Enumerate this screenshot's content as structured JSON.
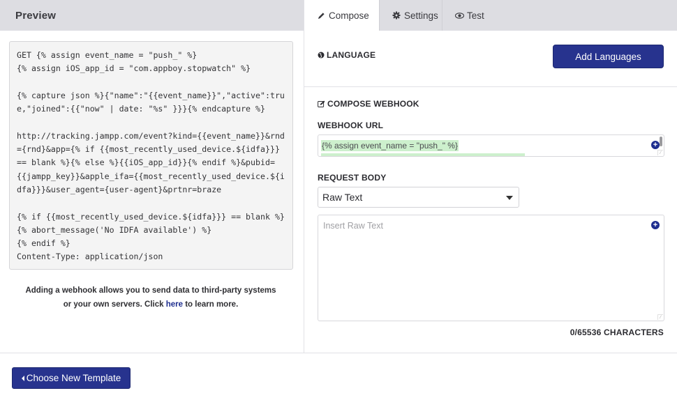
{
  "preview": {
    "title": "Preview",
    "code": "GET {% assign event_name = \"push_\" %}\n{% assign iOS_app_id = \"com.appboy.stopwatch\" %}\n\n{% capture json %}{\"name\":\"{{event_name}}\",\"active\":true,\"joined\":{{\"now\" | date: \"%s\" }}}{% endcapture %}\n\nhttp://tracking.jampp.com/event?kind={{event_name}}&rnd={rnd}&app={% if {{most_recently_used_device.${idfa}}} == blank %}{% else %}{{iOS_app_id}}{% endif %}&pubid={{jampp_key}}&apple_ifa={{most_recently_used_device.${idfa}}}&user_agent={user-agent}&prtnr=braze\n\n{% if {{most_recently_used_device.${idfa}}} == blank %}\n{% abort_message('No IDFA available') %}\n{% endif %}\nContent-Type: application/json",
    "info_before": "Adding a webhook allows you to send data to third-party systems or your own servers. Click ",
    "info_link": "here",
    "info_after": " to learn more."
  },
  "tabs": [
    {
      "label": "Compose",
      "icon": "pencil-icon",
      "active": true
    },
    {
      "label": "Settings",
      "icon": "gear-icon",
      "active": false
    },
    {
      "label": "Test",
      "icon": "eye-icon",
      "active": false
    }
  ],
  "language": {
    "label": "LANGUAGE",
    "add_button": "Add Languages"
  },
  "compose": {
    "section_label": "COMPOSE WEBHOOK",
    "url_label": "WEBHOOK URL",
    "url_value_line1": "{% assign event_name = \"push_\" %}",
    "request_body_label": "REQUEST BODY",
    "request_body_type": "Raw Text",
    "raw_text_placeholder": "Insert Raw Text",
    "char_count": "0/65536 CHARACTERS"
  },
  "footer": {
    "choose_template_button": "Choose New Template"
  },
  "colors": {
    "primary": "#27338e",
    "header_bg": "#dddde2",
    "liquid_highlight": "#cdf0cd"
  }
}
